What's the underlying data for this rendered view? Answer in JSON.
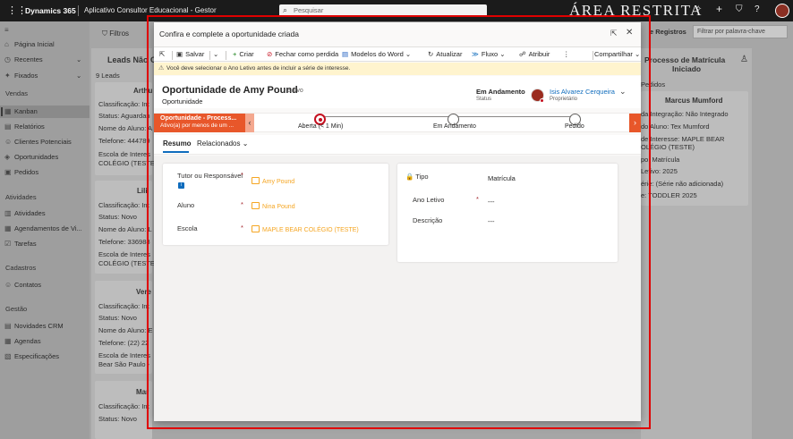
{
  "topbar": {
    "brand": "Dynamics 365",
    "app": "Aplicativo Consultor Educacional - Gestor",
    "search_placeholder": "Pesquisar",
    "area_label": "ÁREA RESTRITA"
  },
  "sidebar": {
    "top_items": [
      "Página Inicial",
      "Recentes",
      "Fixados"
    ],
    "sections": [
      {
        "title": "Vendas",
        "items": [
          "Kanban",
          "Relatórios",
          "Clientes Potenciais",
          "Oportunidades",
          "Pedidos"
        ]
      },
      {
        "title": "Atividades",
        "items": [
          "Atividades",
          "Agendamentos de Vi...",
          "Tarefas"
        ]
      },
      {
        "title": "Cadastros",
        "items": [
          "Contatos"
        ]
      },
      {
        "title": "Gestão",
        "items": [
          "Novidades CRM",
          "Agendas",
          "Especificações"
        ]
      }
    ],
    "selected": "Kanban"
  },
  "background": {
    "filters_label": "Filtros",
    "col1_title": "Leads Não C",
    "col1_count": "9 Leads",
    "cards": [
      {
        "name": "Arthu",
        "lines": [
          "Classificação: Int",
          "Status: Aguardan",
          "Nome do Aluno: A",
          "Telefone: 444789",
          "Escola de Interes",
          "COLÉGIO (TESTE)"
        ]
      },
      {
        "name": "Lili",
        "lines": [
          "Classificação: Int",
          "Status: Novo",
          "Nome do Aluno: L",
          "Telefone: 336988",
          "Escola de Interes",
          "COLÉGIO (TESTE)"
        ]
      },
      {
        "name": "Vere",
        "lines": [
          "Classificação: Int",
          "Status: Novo",
          "Nome do Aluno: E",
          "Telefone: (22) 22",
          "Escola de Interes",
          "Bear São Paulo -"
        ]
      },
      {
        "name": "Mar",
        "lines": [
          "Classificação: Int",
          "Status: Novo"
        ]
      }
    ],
    "right_header": "e Registros",
    "right_filter_placeholder": "Filtrar por palavra-chave",
    "col3_title": "Processo de Matrícula",
    "col3_title2": "Iniciado",
    "col3_sub": "Pedidos",
    "col3_card": {
      "name": "Marcus Mumford",
      "lines": [
        "da Integração: Não Integrado",
        "do Aluno: Tex Mumford",
        "de Interesse: MAPLE BEAR",
        "OLÉGIO (TESTE)",
        "po: Matrícula",
        "Letivo: 2025",
        "érie: (Série não adicionada)",
        "e: TODDLER 2025"
      ]
    }
  },
  "modal": {
    "title": "Confira e complete a oportunidade criada",
    "toolbar": {
      "save": "Salvar",
      "create": "Criar",
      "close_lost": "Fechar como perdida",
      "word": "Modelos do Word",
      "refresh": "Atualizar",
      "flow": "Fluxo",
      "assign": "Atribuir",
      "share": "Compartilhar"
    },
    "warning": "Você deve selecionar o Ano Letivo antes de incluir a série de interesse.",
    "header": {
      "title": "Oportunidade de Amy Pound",
      "saved": "- Salvo",
      "entity": "Oportunidade",
      "status_value": "Em Andamento",
      "status_label": "Status",
      "owner_name": "Isis Alvarez Cerqueira",
      "owner_label": "Proprietário"
    },
    "bpf": {
      "active_title": "Oportunidade - Process...",
      "active_sub": "Ativo(a) por menos de um ...",
      "stages": [
        {
          "label": "Aberta  (< 1 Min)",
          "active": true
        },
        {
          "label": "Em Andamento",
          "active": false
        },
        {
          "label": "Pedido",
          "active": false
        }
      ]
    },
    "tabs": [
      "Resumo",
      "Relacionados"
    ],
    "left_fields": [
      {
        "label": "Tutor ou Responsável",
        "value": "Amy Pound"
      },
      {
        "label": "Aluno",
        "value": "Nina Pound"
      },
      {
        "label": "Escola",
        "value": "MAPLE BEAR COLÉGIO (TESTE)"
      }
    ],
    "right_fields": [
      {
        "label": "Tipo",
        "value": "Matrícula"
      },
      {
        "label": "Ano Letivo",
        "value": "---"
      },
      {
        "label": "Descrição",
        "value": "---"
      }
    ]
  },
  "colors": {
    "accent": "#0f6cbd",
    "bpf_active": "#e8572a",
    "lookup": "#f5a623",
    "frame": "#e00000"
  }
}
